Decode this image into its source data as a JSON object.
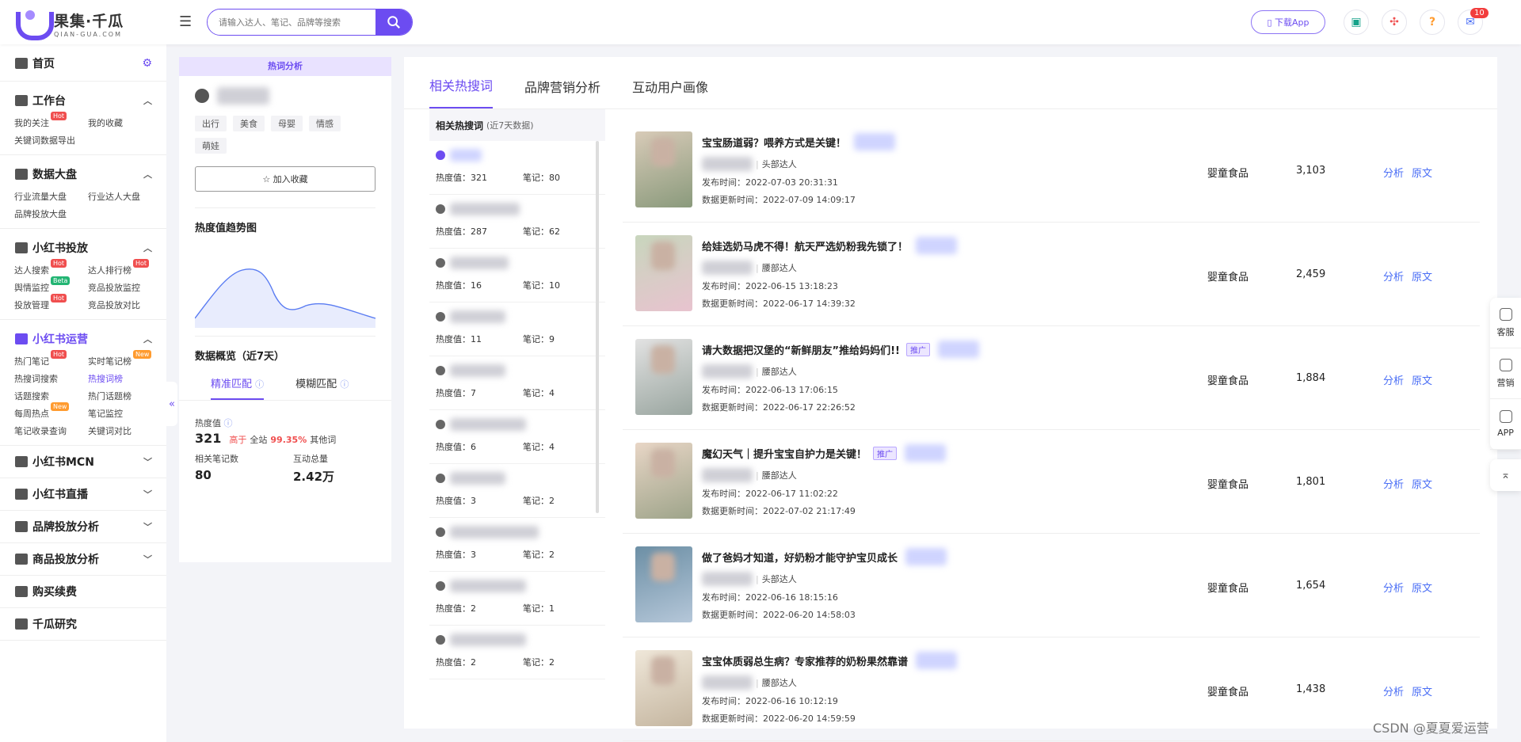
{
  "header": {
    "logo_cn": "果集·千瓜",
    "logo_en": "QIAN-GUA.COM",
    "search_placeholder": "请输入达人、笔记、品牌等搜索",
    "download_label": "下载App",
    "msg_count": "10"
  },
  "sidebar": {
    "home": "首页",
    "sections": [
      {
        "title": "工作台",
        "items": [
          {
            "label": "我的关注",
            "tag": "Hot"
          },
          {
            "label": "我的收藏",
            "tag": ""
          },
          {
            "label": "关键词数据导出",
            "tag": ""
          }
        ]
      },
      {
        "title": "数据大盘",
        "items": [
          {
            "label": "行业流量大盘",
            "tag": ""
          },
          {
            "label": "行业达人大盘",
            "tag": ""
          },
          {
            "label": "品牌投放大盘",
            "tag": ""
          }
        ]
      },
      {
        "title": "小红书投放",
        "items": [
          {
            "label": "达人搜索",
            "tag": "Hot"
          },
          {
            "label": "达人排行榜",
            "tag": "Hot"
          },
          {
            "label": "舆情监控",
            "tag": "Beta"
          },
          {
            "label": "竞品投放监控",
            "tag": ""
          },
          {
            "label": "投放管理",
            "tag": "Hot"
          },
          {
            "label": "竞品投放对比",
            "tag": ""
          }
        ]
      },
      {
        "title": "小红书运营",
        "items": [
          {
            "label": "热门笔记",
            "tag": "Hot"
          },
          {
            "label": "实时笔记榜",
            "tag": "New"
          },
          {
            "label": "热搜词搜索",
            "tag": ""
          },
          {
            "label": "热搜词榜",
            "tag": ""
          },
          {
            "label": "话题搜索",
            "tag": ""
          },
          {
            "label": "热门话题榜",
            "tag": ""
          },
          {
            "label": "每周热点",
            "tag": "New"
          },
          {
            "label": "笔记监控",
            "tag": ""
          },
          {
            "label": "笔记收录查询",
            "tag": ""
          },
          {
            "label": "关键词对比",
            "tag": ""
          }
        ]
      }
    ],
    "collapsed": [
      "小红书MCN",
      "小红书直播",
      "品牌投放分析",
      "商品投放分析",
      "购买续费",
      "千瓜研究"
    ]
  },
  "left_panel": {
    "header": "热词分析",
    "tags": [
      "出行",
      "美食",
      "母婴",
      "情感",
      "萌娃"
    ],
    "fav_label": "加入收藏",
    "trend_title": "热度值趋势图",
    "overview_title": "数据概览（近7天）",
    "tab_exact": "精准匹配",
    "tab_fuzzy": "模糊匹配",
    "heat_label": "热度值",
    "heat_value": "321",
    "heat_higher": "高于",
    "heat_scope": "全站",
    "heat_percent": "99.35%",
    "heat_other": "其他词",
    "related_label": "相关笔记数",
    "related_value": "80",
    "interact_label": "互动总量",
    "interact_value": "2.42万"
  },
  "main_tabs": [
    "相关热搜词",
    "品牌营销分析",
    "互动用户画像"
  ],
  "kwlist": {
    "title": "相关热搜词",
    "subtitle": "(近7天数据)",
    "heat_prefix": "热度值：",
    "note_prefix": "笔记：",
    "items": [
      {
        "heat": "321",
        "notes": "80"
      },
      {
        "heat": "287",
        "notes": "62"
      },
      {
        "heat": "16",
        "notes": "10"
      },
      {
        "heat": "11",
        "notes": "9"
      },
      {
        "heat": "7",
        "notes": "4"
      },
      {
        "heat": "6",
        "notes": "4"
      },
      {
        "heat": "3",
        "notes": "2"
      },
      {
        "heat": "3",
        "notes": "2"
      },
      {
        "heat": "2",
        "notes": "1"
      },
      {
        "heat": "2",
        "notes": "2"
      }
    ]
  },
  "notes": {
    "pub_prefix": "发布时间：",
    "upd_prefix": "数据更新时间：",
    "act_analyze": "分析",
    "act_origin": "原文",
    "items": [
      {
        "title": "宝宝肠道弱？喂养方式是关键！",
        "ad": "",
        "author_type": "头部达人",
        "pub": "2022-07-03 20:31:31",
        "upd": "2022-07-09 14:09:17",
        "cat": "婴童食品",
        "num": "3,103"
      },
      {
        "title": "给娃选奶马虎不得！航天严选奶粉我先锁了！",
        "ad": "",
        "author_type": "腰部达人",
        "pub": "2022-06-15 13:18:23",
        "upd": "2022-06-17 14:39:32",
        "cat": "婴童食品",
        "num": "2,459"
      },
      {
        "title": "请大数据把汉堡的“新鲜朋友”推给妈妈们!!",
        "ad": "推广",
        "author_type": "腰部达人",
        "pub": "2022-06-13 17:06:15",
        "upd": "2022-06-17 22:26:52",
        "cat": "婴童食品",
        "num": "1,884"
      },
      {
        "title": "魔幻天气｜提升宝宝自护力是关键！",
        "ad": "推广",
        "author_type": "腰部达人",
        "pub": "2022-06-17 11:02:22",
        "upd": "2022-07-02 21:17:49",
        "cat": "婴童食品",
        "num": "1,801"
      },
      {
        "title": "做了爸妈才知道，好奶粉才能守护宝贝成长",
        "ad": "",
        "author_type": "头部达人",
        "pub": "2022-06-16 18:15:16",
        "upd": "2022-06-20 14:58:03",
        "cat": "婴童食品",
        "num": "1,654"
      },
      {
        "title": "宝宝体质弱总生病？专家推荐的奶粉果然靠谱",
        "ad": "",
        "author_type": "腰部达人",
        "pub": "2022-06-16 10:12:19",
        "upd": "2022-06-20 14:59:59",
        "cat": "婴童食品",
        "num": "1,438"
      }
    ]
  },
  "float_bar": [
    "客服",
    "营销",
    "APP"
  ],
  "watermark": "CSDN @夏夏爱运营",
  "colors": {
    "accent": "#6c4cf1",
    "hot": "#f04f4f",
    "link": "#4a6ef5"
  }
}
